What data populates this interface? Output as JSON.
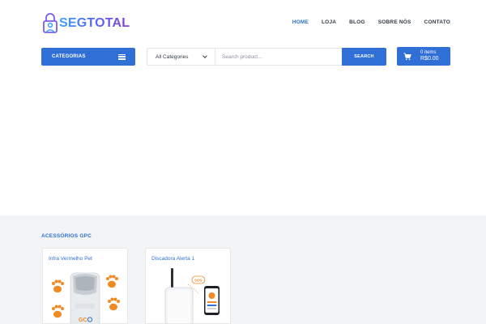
{
  "header": {
    "logo_text": "SEGTOTAL",
    "nav": [
      "HOME",
      "LOJA",
      "BLOG",
      "SOBRE NÓS",
      "CONTATO"
    ],
    "active_nav": "HOME"
  },
  "toolbar": {
    "categories_label": "CATEGORIAS",
    "category_select_value": "All Categories",
    "search_placeholder": "Search product...",
    "search_button_label": "SEARCH",
    "cart_items": "0 items",
    "cart_total": "R$0.00"
  },
  "section": {
    "title": "ACESSÓRIOS GPC",
    "products": [
      {
        "name": "Infra Vermelho Pet"
      },
      {
        "name": "Discadora Alerta 1"
      }
    ]
  },
  "colors": {
    "accent": "#2f6fd6",
    "paw": "#f08a24",
    "section_bg": "#f3f4f6"
  },
  "icons": [
    "lock-person-logo-icon",
    "hamburger-icon",
    "chevron-down-icon",
    "cart-icon"
  ]
}
